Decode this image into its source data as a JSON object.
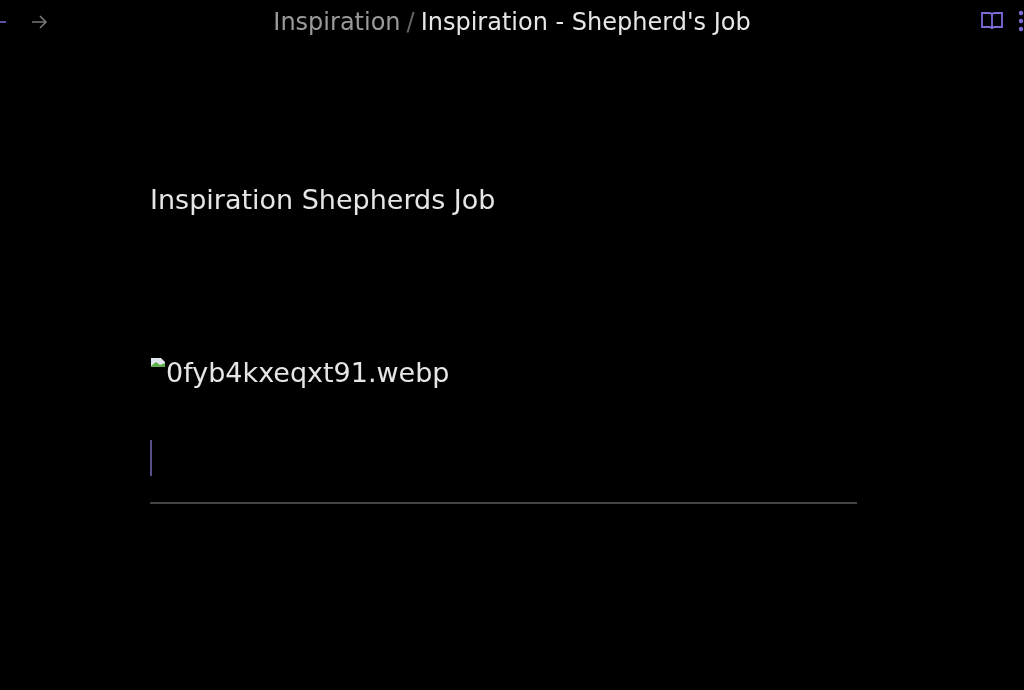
{
  "nav": {
    "back_disabled": false,
    "forward_disabled": true
  },
  "breadcrumb": {
    "parent": "Inspiration",
    "separator": "/",
    "current": "Inspiration - Shepherd's Job"
  },
  "note": {
    "heading": "Inspiration Shepherds Job",
    "image_alt": "0fyb4kxeqxt91.webp"
  }
}
